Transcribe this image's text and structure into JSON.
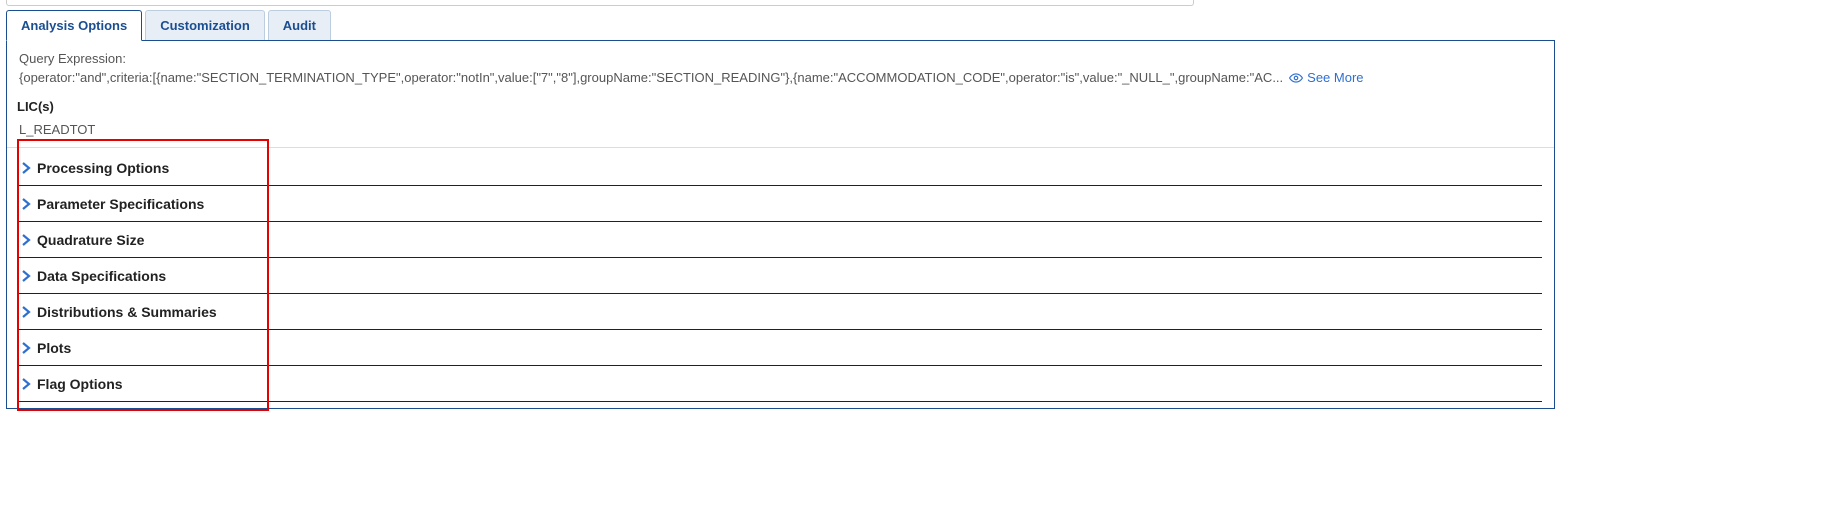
{
  "tabs": {
    "analysis": "Analysis Options",
    "customization": "Customization",
    "audit": "Audit"
  },
  "query": {
    "label": "Query Expression:",
    "text": "{operator:\"and\",criteria:[{name:\"SECTION_TERMINATION_TYPE\",operator:\"notIn\",value:[\"7\",\"8\"],groupName:\"SECTION_READING\"},{name:\"ACCOMMODATION_CODE\",operator:\"is\",value:\"_NULL_\",groupName:\"AC...",
    "see_more": "See More"
  },
  "lic": {
    "label": "LIC(s)",
    "value": "L_READTOT"
  },
  "sections": {
    "processing": "Processing Options",
    "parameters": "Parameter Specifications",
    "quadrature": "Quadrature Size",
    "data_spec": "Data Specifications",
    "distributions": "Distributions & Summaries",
    "plots": "Plots",
    "flags": "Flag Options"
  }
}
